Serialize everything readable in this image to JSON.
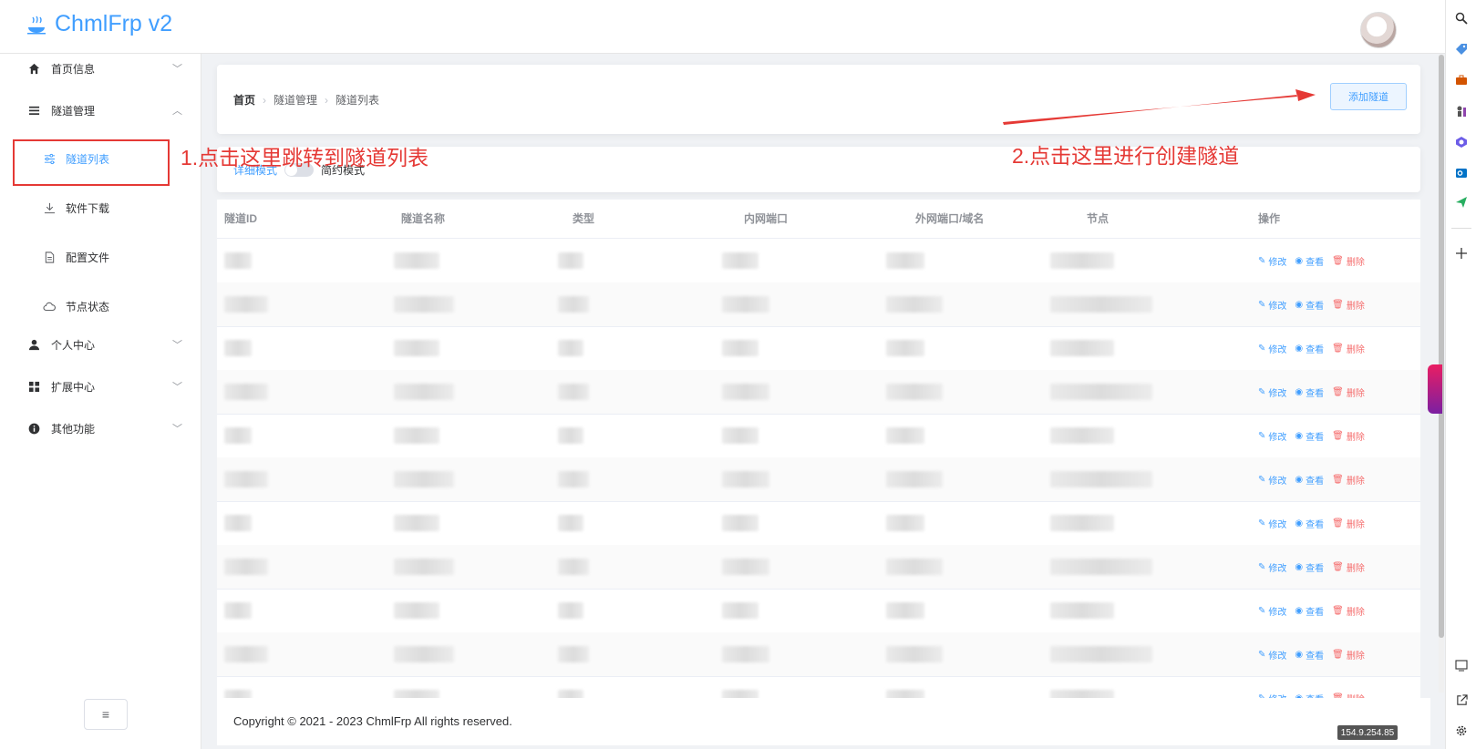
{
  "header": {
    "app_title": "ChmlFrp v2"
  },
  "sidebar": {
    "items": [
      {
        "label": "首页信息"
      },
      {
        "label": "隧道管理"
      },
      {
        "label": "个人中心"
      },
      {
        "label": "扩展中心"
      },
      {
        "label": "其他功能"
      }
    ],
    "sub_items": [
      {
        "label": "隧道列表"
      },
      {
        "label": "软件下载"
      },
      {
        "label": "配置文件"
      },
      {
        "label": "节点状态"
      }
    ],
    "collapse_glyph": "≡"
  },
  "breadcrumb": [
    "首页",
    "隧道管理",
    "隧道列表"
  ],
  "toolbar": {
    "add_tunnel_label": "添加隧道"
  },
  "mode": {
    "detail_label": "详细模式",
    "simple_label": "简约模式"
  },
  "table": {
    "columns": [
      "隧道ID",
      "隧道名称",
      "类型",
      "内网端口",
      "外网端口/域名",
      "节点",
      "操作"
    ],
    "actions": {
      "edit": "修改",
      "view": "查看",
      "delete": "删除"
    }
  },
  "annotations": {
    "step1": "1.点击这里跳转到隧道列表",
    "step2": "2.点击这里进行创建隧道",
    "color": "#e53935"
  },
  "footer": {
    "copyright": "Copyright © 2021 - 2023 ChmlFrp All rights reserved."
  },
  "status": {
    "ip": "154.9.254.85"
  },
  "colors": {
    "primary": "#409eff",
    "danger": "#f56c6c"
  }
}
